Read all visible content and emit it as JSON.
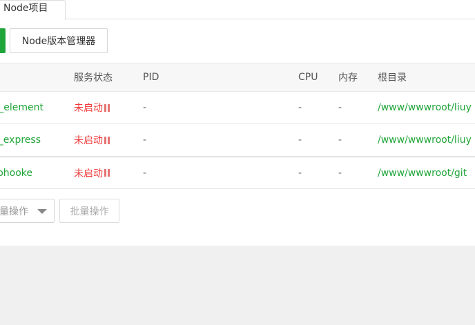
{
  "tabs": [
    {
      "label": "Node项目",
      "active": true
    }
  ],
  "toolbar": {
    "node_manager_label": "Node版本管理器"
  },
  "table": {
    "headers": {
      "status": "服务状态",
      "pid": "PID",
      "cpu": "CPU",
      "mem": "内存",
      "path": "根目录"
    },
    "rows": [
      {
        "name": "_element",
        "status": "未启动",
        "pid": "-",
        "cpu": "-",
        "mem": "-",
        "path": "/www/wwwroot/liuy"
      },
      {
        "name": "_express",
        "status": "未启动",
        "pid": "-",
        "cpu": "-",
        "mem": "-",
        "path": "/www/wwwroot/liuy"
      },
      {
        "name": "ohooke",
        "status": "未启动",
        "pid": "-",
        "cpu": "-",
        "mem": "-",
        "path": "/www/wwwroot/git"
      }
    ]
  },
  "batch": {
    "select_label": "量操作",
    "button_label": "批量操作"
  },
  "colors": {
    "accent": "#20a53a",
    "status_stopped": "#ef0808"
  }
}
